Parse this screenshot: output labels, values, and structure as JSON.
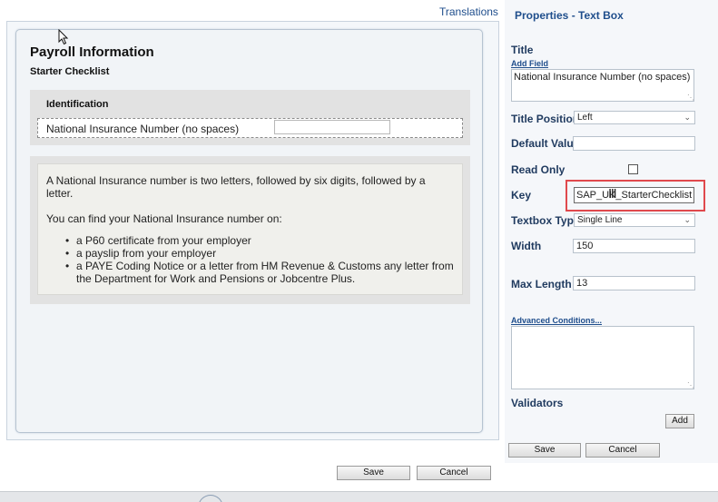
{
  "header": {
    "translations_link": "Translations"
  },
  "form": {
    "title": "Payroll Information",
    "subtitle": "Starter Checklist",
    "identification": {
      "header": "Identification",
      "ni_label": "National Insurance Number (no spaces)",
      "ni_value": ""
    },
    "info": {
      "paragraph1": "A National Insurance number is two letters, followed by six digits, followed by a letter.",
      "paragraph2": "You can find your National Insurance number on:",
      "bullets": [
        "a P60 certificate from your employer",
        "a payslip from your employer",
        "a PAYE Coding Notice or a letter from HM Revenue & Customs any letter from the Department for Work and Pensions or Jobcentre Plus."
      ]
    },
    "save_label": "Save",
    "cancel_label": "Cancel"
  },
  "properties": {
    "title": "Properties - Text Box",
    "title_label": "Title",
    "add_field_link": "Add Field",
    "title_value": "National Insurance Number (no spaces)",
    "title_position_label": "Title Position",
    "title_position_value": "Left",
    "default_value_label": "Default Value",
    "default_value": "",
    "read_only_label": "Read Only",
    "read_only_checked": false,
    "key_label": "Key",
    "key_value": "SAP_UK_StarterChecklist",
    "textbox_type_label": "Textbox Type",
    "textbox_type_value": "Single Line",
    "width_label": "Width",
    "width_value": "150",
    "max_length_label": "Max Length",
    "max_length_value": "13",
    "advanced_conditions_link": "Advanced Conditions...",
    "advanced_conditions_value": "",
    "validators_label": "Validators",
    "add_label": "Add",
    "save_label": "Save",
    "cancel_label": "Cancel",
    "highlight_color": "#e0494d"
  },
  "icons": {
    "mouse_cursor": "arrow-cursor-icon",
    "text_cursor": "i-beam-cursor-icon",
    "dropdown": "chevron-down-icon",
    "resize": "resize-grip-icon"
  }
}
